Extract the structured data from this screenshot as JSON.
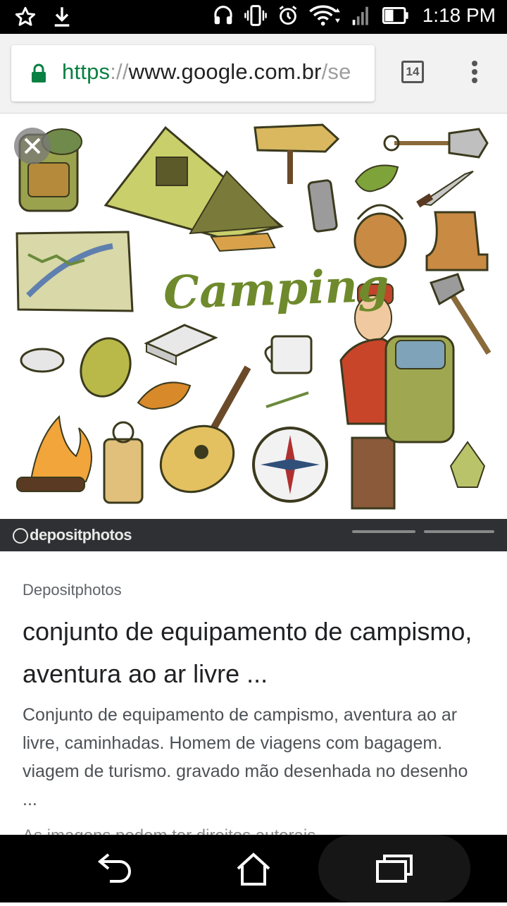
{
  "status_bar": {
    "time": "1:18 PM",
    "left_icons": [
      "star-icon",
      "download-icon"
    ],
    "right_icons": [
      "headset-icon",
      "vibrate-icon",
      "alarm-icon",
      "wifi-icon",
      "signal-icon",
      "battery-icon"
    ]
  },
  "browser": {
    "url_scheme": "https",
    "url_separator": "://",
    "url_host": "www.google.com.br",
    "url_rest": "/se",
    "tab_count": "14",
    "secure_color": "#0b8043"
  },
  "image": {
    "heading": "Camping",
    "watermark": "depositphotos"
  },
  "result": {
    "source": "Depositphotos",
    "title": "conjunto de equipamento de campismo, aventura ao ar livre ...",
    "snippet": "Conjunto de equipamento de campismo, aventura ao ar livre, caminhadas. Homem de viagens com bagagem. viagem de turismo. gravado mão desenhada no desenho ...",
    "cut_text": "As imagens podem ter direitos autorais."
  }
}
